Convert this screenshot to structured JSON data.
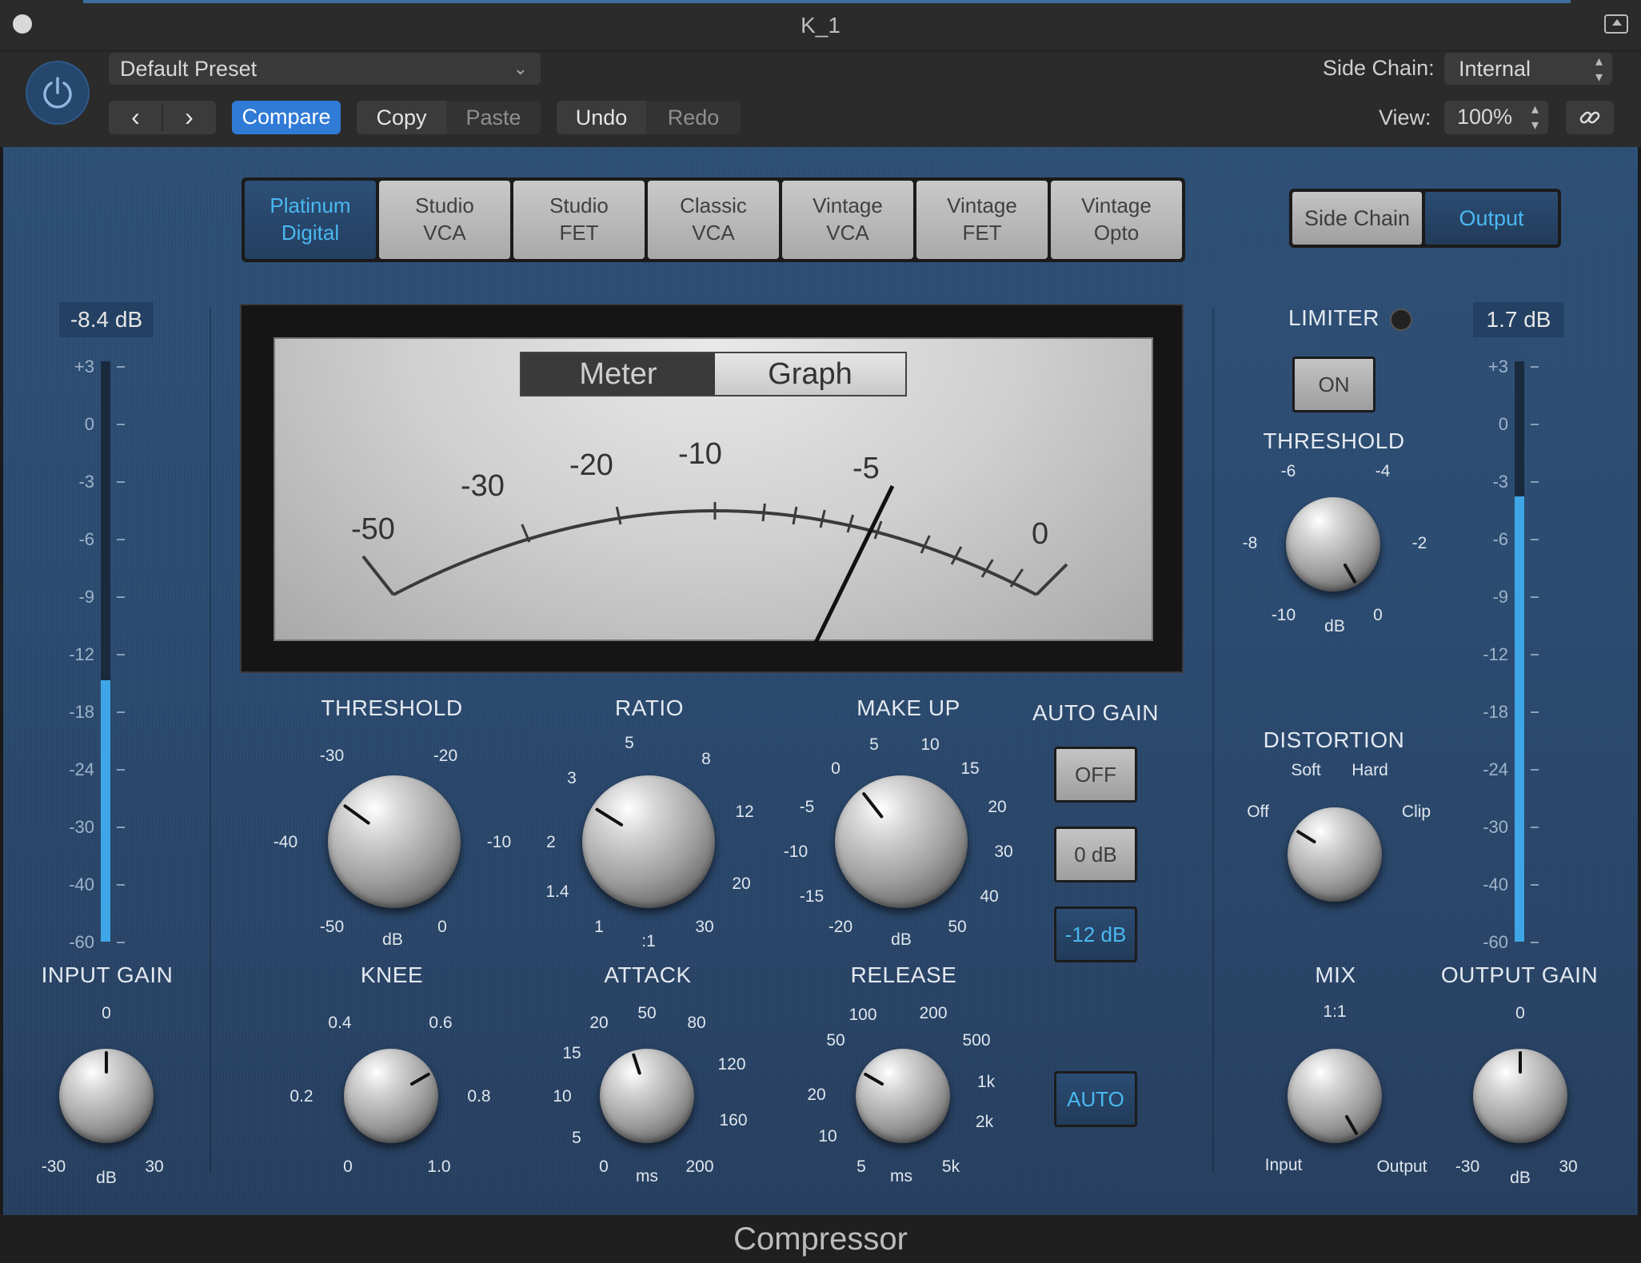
{
  "window": {
    "title": "K_1"
  },
  "header": {
    "preset": "Default Preset",
    "prev_icon": "‹",
    "next_icon": "›",
    "compare": "Compare",
    "copy": "Copy",
    "paste": "Paste",
    "undo": "Undo",
    "redo": "Redo",
    "side_chain_label": "Side Chain:",
    "side_chain_value": "Internal",
    "view_label": "View:",
    "view_value": "100%"
  },
  "models": [
    {
      "line1": "Platinum",
      "line2": "Digital"
    },
    {
      "line1": "Studio",
      "line2": "VCA"
    },
    {
      "line1": "Studio",
      "line2": "FET"
    },
    {
      "line1": "Classic",
      "line2": "VCA"
    },
    {
      "line1": "Vintage",
      "line2": "VCA"
    },
    {
      "line1": "Vintage",
      "line2": "FET"
    },
    {
      "line1": "Vintage",
      "line2": "Opto"
    }
  ],
  "active_model": "Platinum Digital",
  "panel_switch": {
    "side_chain": "Side Chain",
    "output": "Output"
  },
  "meter": {
    "mode_meter": "Meter",
    "mode_graph": "Graph",
    "scale": [
      "-50",
      "-30",
      "-20",
      "-10",
      "-5",
      "0"
    ],
    "needle_value_db": -4.5
  },
  "input": {
    "peak": "-8.4 dB",
    "label": "INPUT GAIN",
    "level_db": -15,
    "knob_min": "-30",
    "knob_max": "30",
    "knob_top": "0",
    "knob_unit": "dB"
  },
  "output": {
    "peak": "1.7 dB",
    "label": "OUTPUT GAIN",
    "level_db": -4,
    "knob_min": "-30",
    "knob_max": "30",
    "knob_top": "0",
    "knob_unit": "dB"
  },
  "meter_scale": [
    "+3",
    "0",
    "-3",
    "-6",
    "-9",
    "-12",
    "-18",
    "-24",
    "-30",
    "-40",
    "-60"
  ],
  "threshold": {
    "label": "THRESHOLD",
    "ticks": [
      "-30",
      "-20",
      "-40",
      "-10",
      "-50",
      "0"
    ],
    "unit": "dB"
  },
  "ratio": {
    "label": "RATIO",
    "ticks": [
      "5",
      "8",
      "3",
      "12",
      "2",
      "20",
      "1.4",
      "30",
      "1"
    ],
    "unit": ":1"
  },
  "makeup": {
    "label": "MAKE UP",
    "ticks": [
      "5",
      "10",
      "0",
      "15",
      "-5",
      "20",
      "-10",
      "30",
      "-15",
      "40",
      "-20",
      "50"
    ],
    "unit": "dB"
  },
  "auto_gain": {
    "label": "AUTO GAIN",
    "off": "OFF",
    "zero": "0 dB",
    "minus12": "-12 dB"
  },
  "knee": {
    "label": "KNEE",
    "ticks": [
      "0.4",
      "0.6",
      "0.2",
      "0.8",
      "0",
      "1.0"
    ]
  },
  "attack": {
    "label": "ATTACK",
    "ticks": [
      "50",
      "20",
      "80",
      "15",
      "120",
      "10",
      "160",
      "5",
      "0",
      "200"
    ],
    "unit": "ms"
  },
  "release": {
    "label": "RELEASE",
    "ticks": [
      "100",
      "200",
      "50",
      "500",
      "1k",
      "20",
      "2k",
      "10",
      "5",
      "5k"
    ],
    "unit": "ms"
  },
  "auto_button": "AUTO",
  "limiter": {
    "label": "LIMITER",
    "on": "ON"
  },
  "limiter_threshold": {
    "label": "THRESHOLD",
    "ticks": [
      "-6",
      "-4",
      "-8",
      "-2",
      "-10",
      "0"
    ],
    "unit": "dB"
  },
  "distortion": {
    "label": "DISTORTION",
    "soft": "Soft",
    "hard": "Hard",
    "off": "Off",
    "clip": "Clip"
  },
  "mix": {
    "label": "MIX",
    "top": "1:1",
    "left": "Input",
    "right": "Output"
  },
  "footer": {
    "title": "Compressor"
  },
  "colors": {
    "accent_blue": "#3ea6e6",
    "compare_blue": "#2f7bd6",
    "panel_blue": "#2e4f76"
  }
}
